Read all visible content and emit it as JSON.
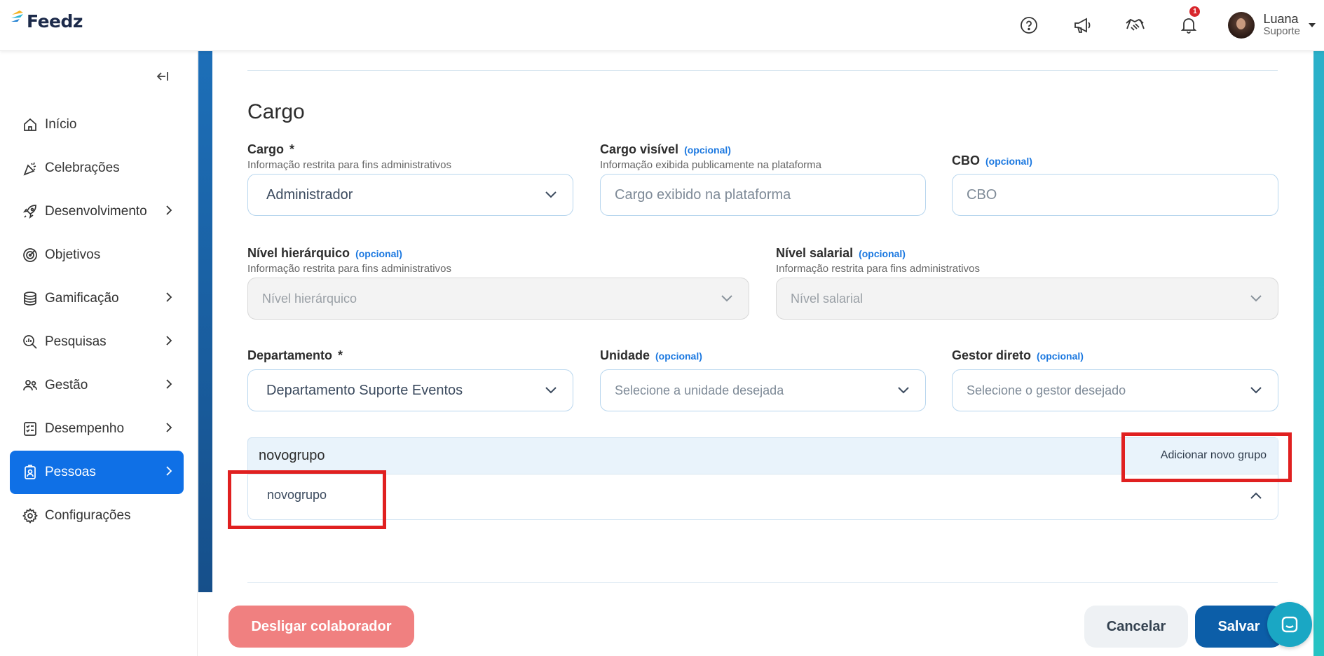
{
  "app": {
    "logo_text": "Feedz"
  },
  "header": {
    "notification_count": "1",
    "user_name": "Luana",
    "user_role": "Suporte"
  },
  "sidebar": {
    "items": [
      {
        "label": "Início",
        "icon": "home-icon",
        "has_submenu": false
      },
      {
        "label": "Celebrações",
        "icon": "party-popper-icon",
        "has_submenu": false
      },
      {
        "label": "Desenvolvimento",
        "icon": "rocket-icon",
        "has_submenu": true
      },
      {
        "label": "Objetivos",
        "icon": "target-icon",
        "has_submenu": false
      },
      {
        "label": "Gamificação",
        "icon": "coins-icon",
        "has_submenu": true
      },
      {
        "label": "Pesquisas",
        "icon": "search-chart-icon",
        "has_submenu": true
      },
      {
        "label": "Gestão",
        "icon": "people-icon",
        "has_submenu": true
      },
      {
        "label": "Desempenho",
        "icon": "checklist-icon",
        "has_submenu": true
      },
      {
        "label": "Pessoas",
        "icon": "id-badge-icon",
        "has_submenu": true,
        "active": true
      },
      {
        "label": "Configurações",
        "icon": "gear-icon",
        "has_submenu": false
      }
    ]
  },
  "form": {
    "section_title": "Cargo",
    "optional_tag": "(opcional)",
    "required_mark": "*",
    "cargo": {
      "label": "Cargo",
      "help": "Informação restrita para fins administrativos",
      "value": "Administrador"
    },
    "cargo_visivel": {
      "label": "Cargo visível",
      "help": "Informação exibida publicamente na plataforma",
      "placeholder": "Cargo exibido na plataforma"
    },
    "cbo": {
      "label": "CBO",
      "placeholder": "CBO"
    },
    "nivel_hierarquico": {
      "label": "Nível hierárquico",
      "help": "Informação restrita para fins administrativos",
      "placeholder": "Nível hierárquico"
    },
    "nivel_salarial": {
      "label": "Nível salarial",
      "help": "Informação restrita para fins administrativos",
      "placeholder": "Nível salarial"
    },
    "departamento": {
      "label": "Departamento",
      "value": "Departamento Suporte Eventos"
    },
    "unidade": {
      "label": "Unidade",
      "placeholder": "Selecione a unidade desejada"
    },
    "gestor": {
      "label": "Gestor direto",
      "placeholder": "Selecione o gestor desejado"
    },
    "grupo": {
      "input_value": "novogrupo",
      "add_label": "Adicionar novo grupo",
      "option": "novogrupo"
    }
  },
  "footer": {
    "dismiss_label": "Desligar colaborador",
    "cancel_label": "Cancelar",
    "save_label": "Salvar"
  },
  "colors": {
    "primary": "#0f70e6",
    "save": "#0c5ea8",
    "dismiss": "#f08080",
    "optional_tag": "#1b78e0",
    "highlight_box": "#e02020"
  }
}
